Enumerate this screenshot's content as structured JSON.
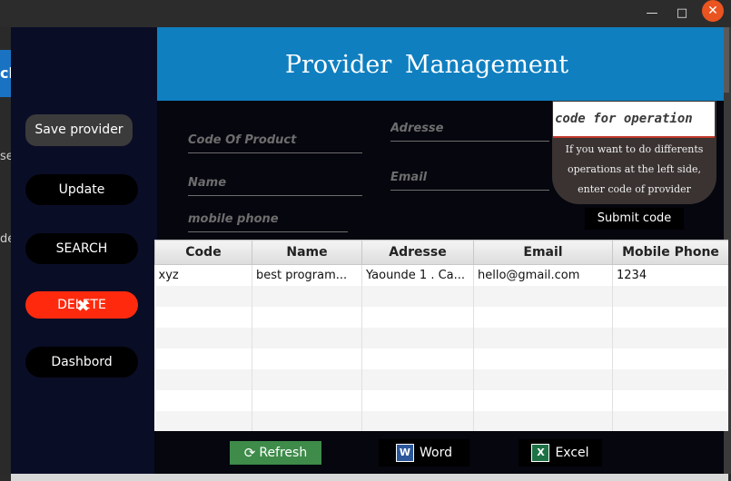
{
  "window": {
    "minimize_icon": "minimize-icon",
    "maximize_icon": "maximize-icon",
    "close_icon": "close-icon"
  },
  "background_app": {
    "tab_fragment": "cl",
    "text1": "se",
    "text2": "de"
  },
  "header": {
    "title": "Provider  Management",
    "color": "#0f7fc0"
  },
  "sidebar": {
    "save": "Save provider",
    "update": "Update",
    "search": "SEARCH",
    "delete": "DELETE",
    "dashboard": "Dashbord",
    "delete_color": "#ff2a0e"
  },
  "form": {
    "code_placeholder": "Code Of Product",
    "name_placeholder": "Name",
    "phone_placeholder": "mobile phone",
    "adresse_placeholder": "Adresse",
    "email_placeholder": "Email",
    "operation_placeholder": "code for operation",
    "operation_help": "If you want to do differents operations at the left side, enter code of provider",
    "submit": "Submit code"
  },
  "table": {
    "columns": [
      "Code",
      "Name",
      "Adresse",
      "Email",
      "Mobile Phone"
    ],
    "rows": [
      [
        "xyz",
        "best program...",
        "Yaounde 1 . Ca...",
        "hello@gmail.com",
        "1234"
      ]
    ]
  },
  "footer": {
    "refresh": "Refresh",
    "word": "Word",
    "excel": "Excel",
    "refresh_color": "#3e8b4a"
  }
}
